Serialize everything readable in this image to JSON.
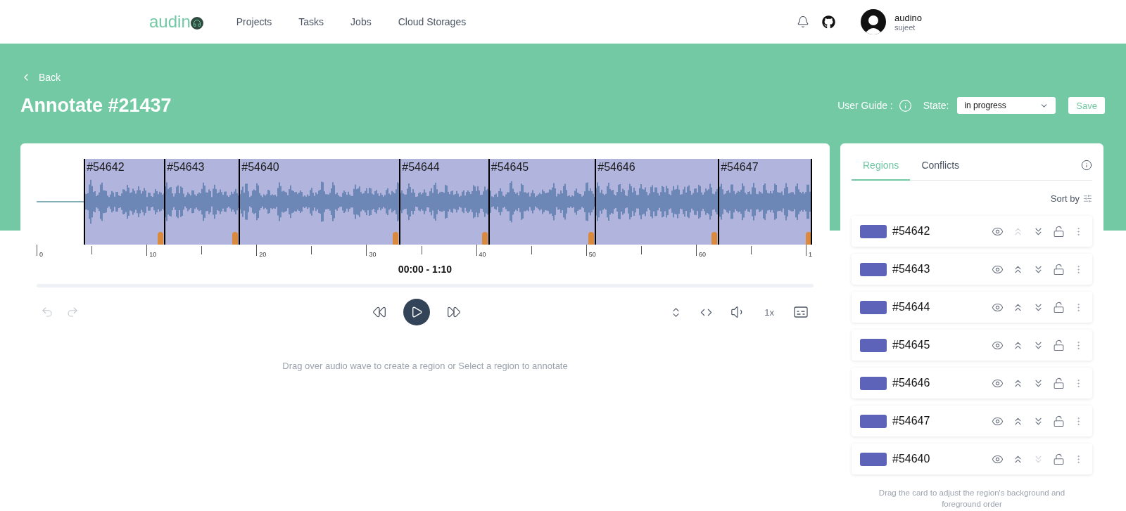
{
  "header": {
    "logo": "audin",
    "nav": [
      {
        "label": "Projects",
        "selected": false
      },
      {
        "label": "Tasks",
        "selected": false
      },
      {
        "label": "Jobs",
        "selected": false
      },
      {
        "label": "Cloud Storages",
        "selected": false
      }
    ],
    "user": {
      "name": "audino",
      "username": "sujeet"
    }
  },
  "page": {
    "back": "Back",
    "title": "Annotate #21437",
    "user_guide": "User Guide :",
    "state_label": "State:",
    "state_value": "in progress",
    "save": "Save"
  },
  "editor": {
    "regions": [
      {
        "label": "#54642"
      },
      {
        "label": "#54643"
      },
      {
        "label": "#54640"
      },
      {
        "label": "#54644"
      },
      {
        "label": "#54645"
      },
      {
        "label": "#54646"
      },
      {
        "label": "#54647"
      }
    ],
    "ticks": [
      "0",
      "10",
      "20",
      "30",
      "40",
      "50",
      "60",
      "1"
    ],
    "time_range": "00:00 - 1:10",
    "speed": "1x",
    "hint": "Drag over audio wave to create a region or Select a region to annotate"
  },
  "panel": {
    "tabs": [
      {
        "label": "Regions",
        "selected": true
      },
      {
        "label": "Conflicts",
        "selected": false
      }
    ],
    "sort": "Sort by",
    "items": [
      {
        "label": "#54642",
        "color": "#5c63b8",
        "up_enabled": false,
        "down_enabled": true
      },
      {
        "label": "#54643",
        "color": "#5c63b8",
        "up_enabled": true,
        "down_enabled": true
      },
      {
        "label": "#54644",
        "color": "#5c63b8",
        "up_enabled": true,
        "down_enabled": true
      },
      {
        "label": "#54645",
        "color": "#5c63b8",
        "up_enabled": true,
        "down_enabled": true
      },
      {
        "label": "#54646",
        "color": "#5c63b8",
        "up_enabled": true,
        "down_enabled": true
      },
      {
        "label": "#54647",
        "color": "#5c63b8",
        "up_enabled": true,
        "down_enabled": true
      },
      {
        "label": "#54640",
        "color": "#5c63b8",
        "up_enabled": true,
        "down_enabled": false
      }
    ],
    "footer": "Drag the card to adjust the region's background and foreground order"
  }
}
